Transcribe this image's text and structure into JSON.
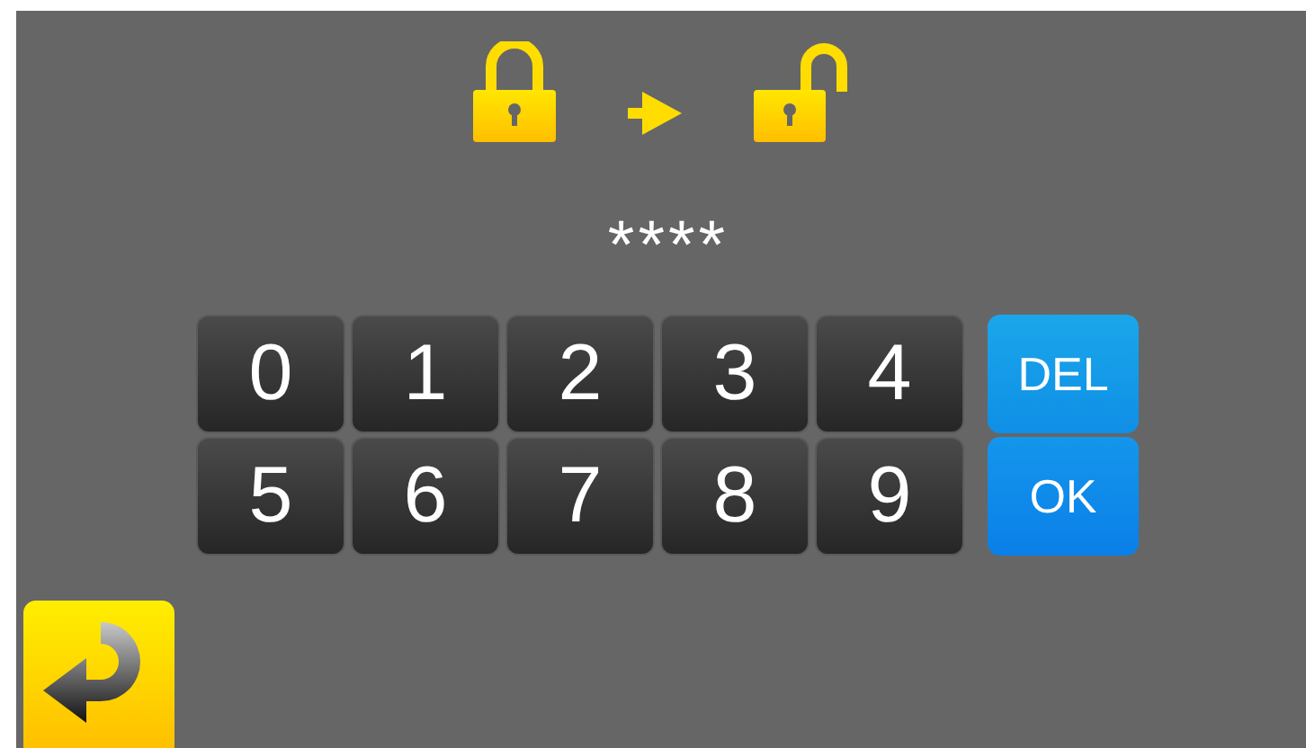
{
  "code": "****",
  "keys": [
    "0",
    "1",
    "2",
    "3",
    "4",
    "5",
    "6",
    "7",
    "8",
    "9"
  ],
  "actions": [
    {
      "label": "DEL"
    },
    {
      "label": "OK"
    }
  ]
}
